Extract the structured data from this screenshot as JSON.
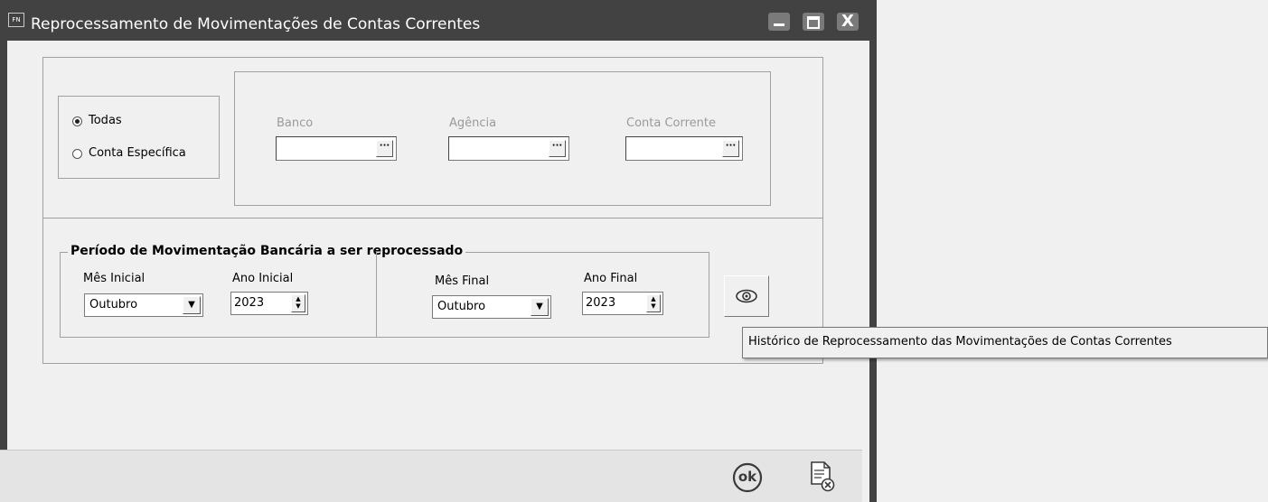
{
  "window": {
    "icon_text": "FN",
    "title": "Reprocessamento de Movimentações de Contas Correntes",
    "controls": [
      "minimize-icon",
      "maximize-icon",
      "close-icon"
    ],
    "close_glyph": "X"
  },
  "account_selection": {
    "options": [
      {
        "label": "Todas",
        "checked": true
      },
      {
        "label": "Conta Específica",
        "checked": false
      }
    ],
    "fields": [
      {
        "label": "Banco",
        "value": "",
        "enabled": false
      },
      {
        "label": "Agência",
        "value": "",
        "enabled": false
      },
      {
        "label": "Conta Corrente",
        "value": "",
        "enabled": false
      }
    ],
    "lookup_glyph": "···"
  },
  "period": {
    "title": "Período de Movimentação Bancária a ser reprocessado",
    "start_month_label": "Mês Inicial",
    "start_month": "Outubro",
    "start_year_label": "Ano Inicial",
    "start_year": "2023",
    "end_month_label": "Mês Final",
    "end_month": "Outubro",
    "end_year_label": "Ano Final",
    "end_year": "2023"
  },
  "history_button": {
    "icon": "eye-icon",
    "tooltip": "Histórico de Reprocessamento das Movimentações de Contas Correntes"
  },
  "footer": {
    "ok_icon": "ok-icon",
    "ok_text": "ok",
    "cancel_icon": "cancel-document-icon"
  },
  "colors": {
    "titlebar": "#424242",
    "background": "#f0f0f0",
    "footer": "#e4e4e4"
  }
}
